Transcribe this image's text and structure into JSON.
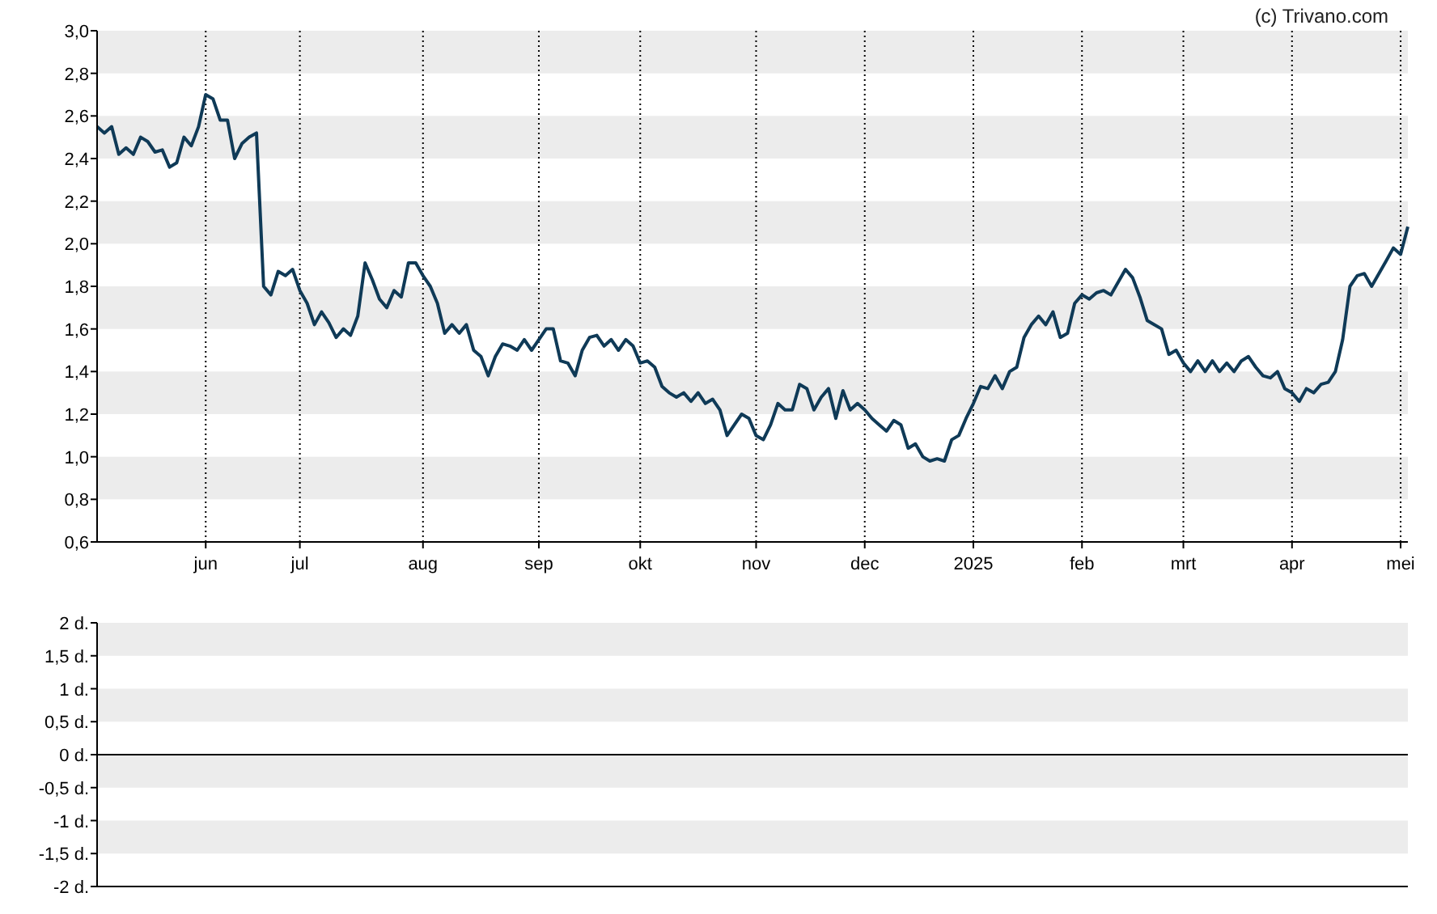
{
  "copyright": "(c) Trivano.com",
  "price_chart": {
    "chart_data": {
      "type": "line",
      "ylim": [
        0.6,
        3.0
      ],
      "yticks": [
        {
          "value": 0.6,
          "label": "0,6"
        },
        {
          "value": 0.8,
          "label": "0,8"
        },
        {
          "value": 1.0,
          "label": "1,0"
        },
        {
          "value": 1.2,
          "label": "1,2"
        },
        {
          "value": 1.4,
          "label": "1,4"
        },
        {
          "value": 1.6,
          "label": "1,6"
        },
        {
          "value": 1.8,
          "label": "1,8"
        },
        {
          "value": 2.0,
          "label": "2,0"
        },
        {
          "value": 2.2,
          "label": "2,2"
        },
        {
          "value": 2.4,
          "label": "2,4"
        },
        {
          "value": 2.6,
          "label": "2,6"
        },
        {
          "value": 2.8,
          "label": "2,8"
        },
        {
          "value": 3.0,
          "label": "3,0"
        }
      ],
      "categories": [
        null,
        null,
        null,
        null,
        null,
        null,
        null,
        null,
        null,
        null,
        null,
        null,
        null,
        null,
        null,
        "jun",
        null,
        null,
        null,
        null,
        null,
        null,
        null,
        null,
        null,
        null,
        null,
        null,
        "jul",
        null,
        null,
        null,
        null,
        null,
        null,
        null,
        null,
        null,
        null,
        null,
        null,
        null,
        null,
        null,
        null,
        "aug",
        null,
        null,
        null,
        null,
        null,
        null,
        null,
        null,
        null,
        null,
        null,
        null,
        null,
        null,
        null,
        "sep",
        null,
        null,
        null,
        null,
        null,
        null,
        null,
        null,
        null,
        null,
        null,
        null,
        null,
        "okt",
        null,
        null,
        null,
        null,
        null,
        null,
        null,
        null,
        null,
        null,
        null,
        null,
        null,
        null,
        null,
        "nov",
        null,
        null,
        null,
        null,
        null,
        null,
        null,
        null,
        null,
        null,
        null,
        null,
        null,
        null,
        "dec",
        null,
        null,
        null,
        null,
        null,
        null,
        null,
        null,
        null,
        null,
        null,
        null,
        null,
        null,
        "2025",
        null,
        null,
        null,
        null,
        null,
        null,
        null,
        null,
        null,
        null,
        null,
        null,
        null,
        null,
        "feb",
        null,
        null,
        null,
        null,
        null,
        null,
        null,
        null,
        null,
        null,
        null,
        null,
        null,
        "mrt",
        null,
        null,
        null,
        null,
        null,
        null,
        null,
        null,
        null,
        null,
        null,
        null,
        null,
        null,
        "apr",
        null,
        null,
        null,
        null,
        null,
        null,
        null,
        null,
        null,
        null,
        null,
        null,
        null,
        null,
        "mei",
        null
      ],
      "series": [
        {
          "color": "#0f3a57",
          "values": [
            2.55,
            2.52,
            2.55,
            2.42,
            2.45,
            2.42,
            2.5,
            2.48,
            2.43,
            2.44,
            2.36,
            2.38,
            2.5,
            2.46,
            2.55,
            2.7,
            2.68,
            2.58,
            2.58,
            2.4,
            2.47,
            2.5,
            2.52,
            1.8,
            1.76,
            1.87,
            1.85,
            1.88,
            1.78,
            1.72,
            1.62,
            1.68,
            1.63,
            1.56,
            1.6,
            1.57,
            1.66,
            1.91,
            1.83,
            1.74,
            1.7,
            1.78,
            1.75,
            1.91,
            1.91,
            1.85,
            1.8,
            1.72,
            1.58,
            1.62,
            1.58,
            1.62,
            1.5,
            1.47,
            1.38,
            1.47,
            1.53,
            1.52,
            1.5,
            1.55,
            1.5,
            1.55,
            1.6,
            1.6,
            1.45,
            1.44,
            1.38,
            1.5,
            1.56,
            1.57,
            1.52,
            1.55,
            1.5,
            1.55,
            1.52,
            1.44,
            1.45,
            1.42,
            1.33,
            1.3,
            1.28,
            1.3,
            1.26,
            1.3,
            1.25,
            1.27,
            1.22,
            1.1,
            1.15,
            1.2,
            1.18,
            1.1,
            1.08,
            1.15,
            1.25,
            1.22,
            1.22,
            1.34,
            1.32,
            1.22,
            1.28,
            1.32,
            1.18,
            1.31,
            1.22,
            1.25,
            1.22,
            1.18,
            1.15,
            1.12,
            1.17,
            1.15,
            1.04,
            1.06,
            1.0,
            0.98,
            0.99,
            0.98,
            1.08,
            1.1,
            1.18,
            1.25,
            1.33,
            1.32,
            1.38,
            1.32,
            1.4,
            1.42,
            1.56,
            1.62,
            1.66,
            1.62,
            1.68,
            1.56,
            1.58,
            1.72,
            1.76,
            1.74,
            1.77,
            1.78,
            1.76,
            1.82,
            1.88,
            1.84,
            1.75,
            1.64,
            1.62,
            1.6,
            1.48,
            1.5,
            1.44,
            1.4,
            1.45,
            1.4,
            1.45,
            1.4,
            1.44,
            1.4,
            1.45,
            1.47,
            1.42,
            1.38,
            1.37,
            1.4,
            1.32,
            1.3,
            1.26,
            1.32,
            1.3,
            1.34,
            1.35,
            1.4,
            1.55,
            1.8,
            1.85,
            1.86,
            1.8,
            1.86,
            1.92,
            1.98,
            1.95,
            2.08
          ]
        }
      ]
    }
  },
  "volume_chart": {
    "axis_labels": [
      "2 d.",
      "1,5 d.",
      "1 d.",
      "0,5 d.",
      "0 d.",
      "-0,5 d.",
      "-1 d.",
      "-1,5 d.",
      "-2 d."
    ]
  }
}
